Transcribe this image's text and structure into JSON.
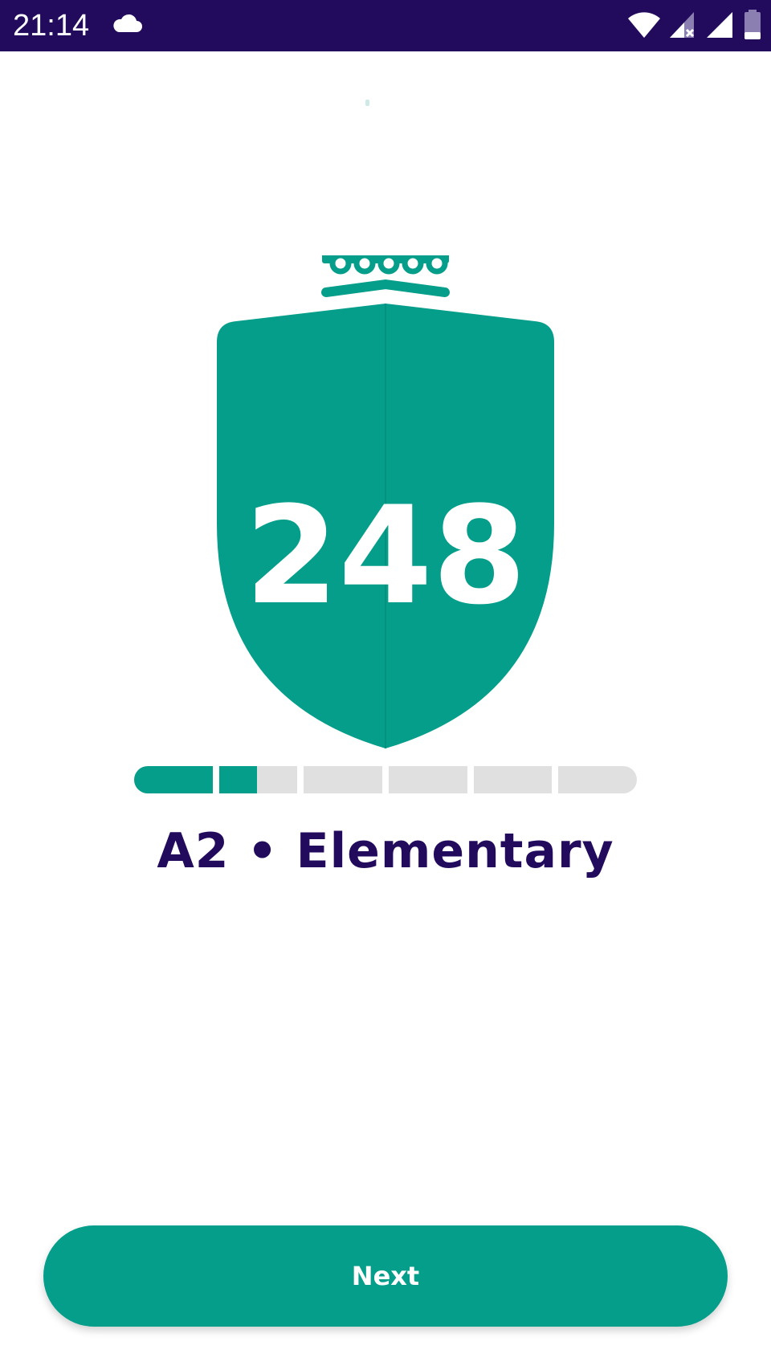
{
  "status_bar": {
    "time": "21:14",
    "icons": [
      "cloud-icon",
      "wifi-icon",
      "signal-no-sim-icon",
      "signal-icon",
      "battery-icon"
    ]
  },
  "badge": {
    "score": "248",
    "color": "#049e8a"
  },
  "level": {
    "label": "A2 • Elementary",
    "segments": [
      1.0,
      0.48,
      0,
      0,
      0,
      0
    ],
    "color": "#220a5c"
  },
  "actions": {
    "next_label": "Next"
  }
}
